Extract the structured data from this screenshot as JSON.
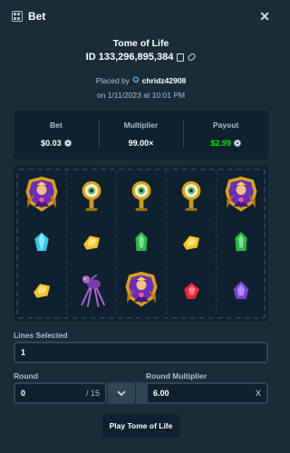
{
  "header": {
    "title": "Bet",
    "close_icon": "close-icon"
  },
  "bet": {
    "game": "Tome of Life",
    "id": "ID 133,296,895,384",
    "placed_by_label": "Placed by",
    "username": "chridz42908",
    "date": "on 1/11/2023 at 10:01 PM"
  },
  "stats": {
    "bet_label": "Bet",
    "bet_value": "$0.03",
    "multiplier_label": "Multiplier",
    "multiplier_value": "99.00×",
    "payout_label": "Payout",
    "payout_value": "$2.99"
  },
  "reels": [
    [
      "queen",
      "eye-lamp",
      "eye-lamp",
      "eye-lamp",
      "queen"
    ],
    [
      "blue-gem",
      "yellow-gem",
      "green-gem",
      "yellow-gem",
      "green-gem"
    ],
    [
      "yellow-gem",
      "spider",
      "queen",
      "red-gem",
      "purple-gem"
    ]
  ],
  "lines": {
    "label": "Lines Selected",
    "value": "1"
  },
  "round": {
    "label": "Round",
    "value": "0",
    "suffix": "/ 15"
  },
  "round_multiplier": {
    "label": "Round Multiplier",
    "value": "6.00",
    "suffix": "X"
  },
  "play_button": {
    "label": "Play Tome of Life"
  },
  "colors": {
    "background": "#1a2c38",
    "panel": "#0f212e",
    "border": "#2f4553",
    "muted_text": "#b1bad3",
    "payout_green": "#00e701"
  }
}
